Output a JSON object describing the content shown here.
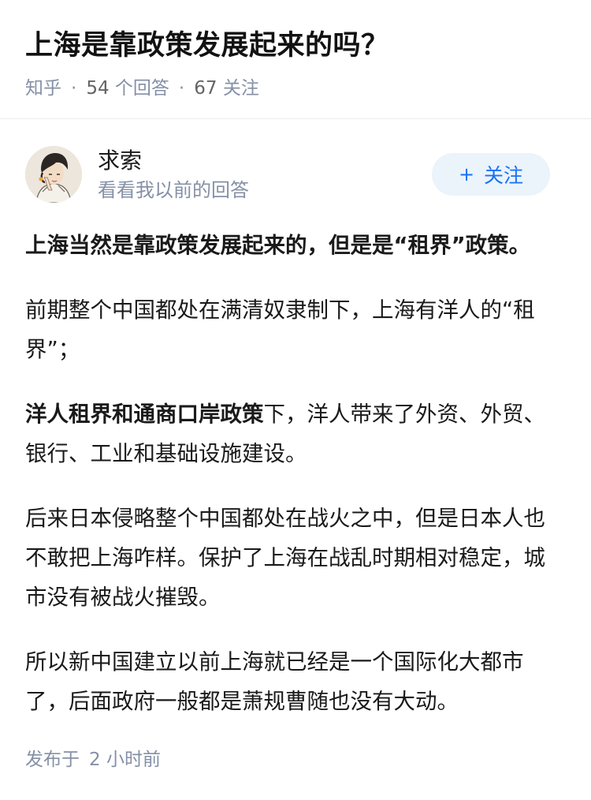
{
  "question": {
    "title": "上海是靠政策发展起来的吗？",
    "source": "知乎",
    "answer_count": "54",
    "answer_unit": "个回答",
    "follower_count": "67",
    "follower_unit": "关注",
    "separator": "·"
  },
  "author": {
    "name": "求索",
    "subtitle": "看看我以前的回答",
    "avatar_icon": "avatar-illustration-icon",
    "follow_label": "关注",
    "follow_icon": "plus-icon"
  },
  "answer": {
    "p1_bold": "上海当然是靠政策发展起来的，但是是“租界”政策。",
    "p2": "前期整个中国都处在满清奴隶制下，上海有洋人的“租界”；",
    "p3_bold": "洋人租界和通商口岸政策",
    "p3_rest": "下，洋人带来了外资、外贸、银行、工业和基础设施建设。",
    "p4": "后来日本侵略整个中国都处在战火之中，但是日本人也不敢把上海咋样。保护了上海在战乱时期相对稳定，城市没有被战火摧毁。",
    "p5": "所以新中国建立以前上海就已经是一个国际化大都市了，后面政府一般都是萧规曹随也没有大动。"
  },
  "footer": {
    "published_label": "发布于",
    "published_time": "2 小时前"
  },
  "colors": {
    "meta_gray": "#8590a6",
    "accent_blue": "#1772f6",
    "follow_bg": "#ebf3fb"
  }
}
